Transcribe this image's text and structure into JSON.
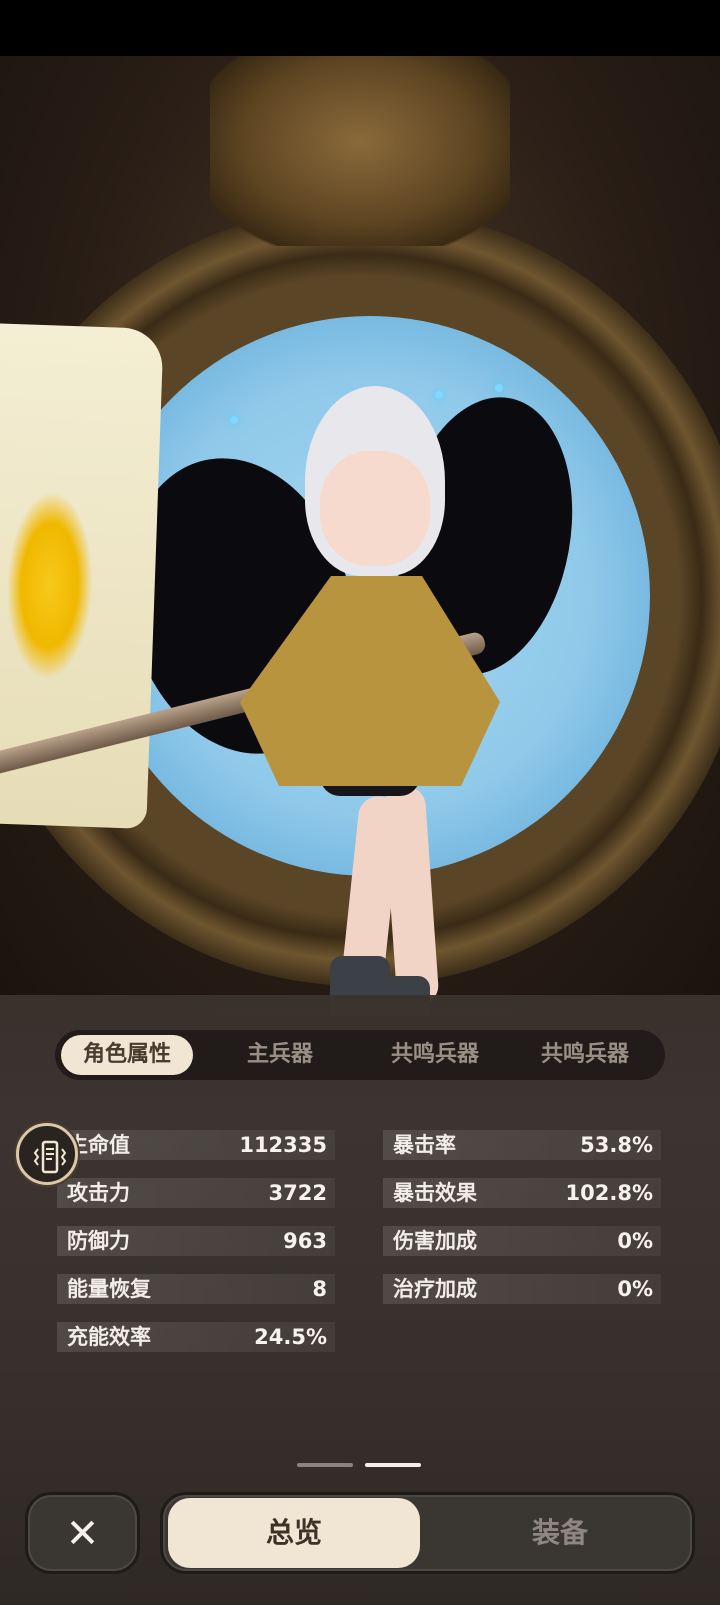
{
  "tabs": [
    {
      "label": "角色属性",
      "active": true
    },
    {
      "label": "主兵器",
      "active": false
    },
    {
      "label": "共鸣兵器",
      "active": false
    },
    {
      "label": "共鸣兵器",
      "active": false
    }
  ],
  "stats_left": [
    {
      "label": "生命值",
      "value": "112335"
    },
    {
      "label": "攻击力",
      "value": "3722"
    },
    {
      "label": "防御力",
      "value": "963"
    },
    {
      "label": "能量恢复",
      "value": "8"
    },
    {
      "label": "充能效率",
      "value": "24.5%"
    }
  ],
  "stats_right": [
    {
      "label": "暴击率",
      "value": "53.8%"
    },
    {
      "label": "暴击效果",
      "value": "102.8%"
    },
    {
      "label": "伤害加成",
      "value": "0%"
    },
    {
      "label": "治疗加成",
      "value": "0%"
    }
  ],
  "pager": {
    "pages": 2,
    "current": 2
  },
  "bottom": {
    "close_label": "✕",
    "overview_label": "总览",
    "equip_label": "装备"
  },
  "icons": {
    "vibration": "phone-vibrate-icon",
    "close": "close-icon"
  }
}
